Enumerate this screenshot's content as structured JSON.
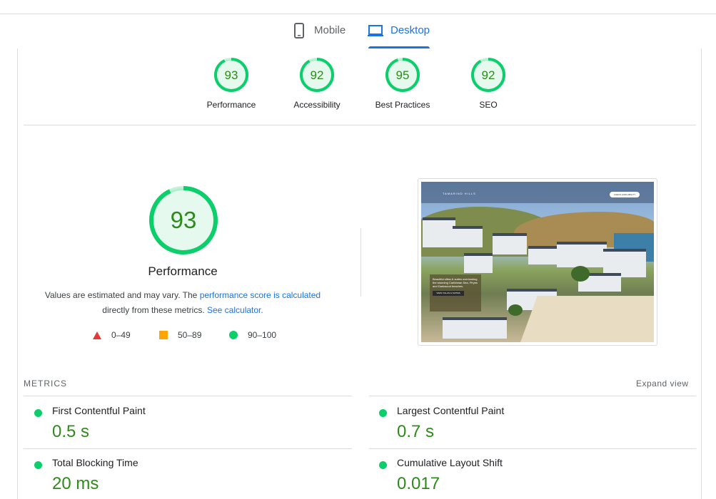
{
  "tabs": [
    {
      "label": "Mobile",
      "icon": "phone-icon",
      "active": false
    },
    {
      "label": "Desktop",
      "icon": "laptop-icon",
      "active": true
    }
  ],
  "colors": {
    "accent": "#1a73e8",
    "pass": "#0cce6b",
    "pass_text": "#2e8a1a",
    "average": "#ffa400",
    "fail": "#ff4e42"
  },
  "scores": [
    {
      "value": "93",
      "label": "Performance"
    },
    {
      "value": "92",
      "label": "Accessibility"
    },
    {
      "value": "95",
      "label": "Best Practices"
    },
    {
      "value": "92",
      "label": "SEO"
    }
  ],
  "performance": {
    "score": "93",
    "title": "Performance",
    "desc_prefix": "Values are estimated and may vary. The",
    "desc_link1": "performance score is calculated",
    "desc_middle": "directly from these metrics.",
    "desc_link2": "See calculator."
  },
  "legend": [
    {
      "range": "0–49",
      "shape": "triangle"
    },
    {
      "range": "50–89",
      "shape": "square"
    },
    {
      "range": "90–100",
      "shape": "circle"
    }
  ],
  "screenshot": {
    "logo": "TAMARIND HILLS",
    "cta": "CHECK AVAILABILITY",
    "card_text": "Beautiful villas & suites overlooking the stunning Caribbean Sea, Ffryes and Darkwood beaches.",
    "card_button": "VIEW VILLAS & SUITES"
  },
  "metrics": {
    "title": "METRICS",
    "expand": "Expand view",
    "items": [
      {
        "name": "First Contentful Paint",
        "value": "0.5 s"
      },
      {
        "name": "Largest Contentful Paint",
        "value": "0.7 s"
      },
      {
        "name": "Total Blocking Time",
        "value": "20 ms"
      },
      {
        "name": "Cumulative Layout Shift",
        "value": "0.017"
      }
    ]
  }
}
